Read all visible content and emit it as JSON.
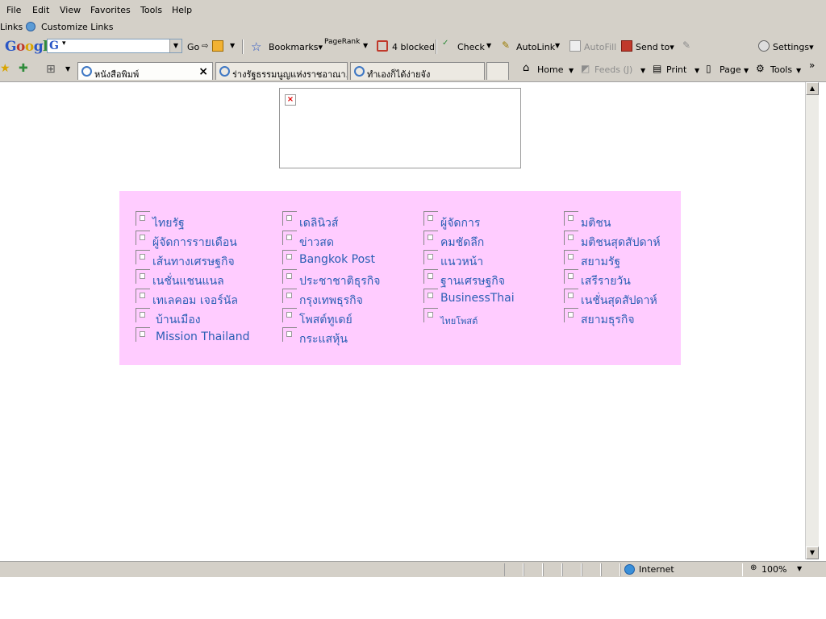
{
  "menubar": {
    "items": [
      "File",
      "Edit",
      "View",
      "Favorites",
      "Tools",
      "Help"
    ]
  },
  "linksbar": {
    "label": "Links",
    "customize": "Customize Links"
  },
  "google_toolbar": {
    "logo": "Google",
    "search_value": "",
    "go": "Go",
    "bookmarks": "Bookmarks",
    "pagerank": "PageRank",
    "pagerank_fraction": 0.55,
    "blocked": "4 blocked",
    "check": "Check",
    "autolink": "AutoLink",
    "autofill": "AutoFill",
    "sendto": "Send to",
    "settings": "Settings"
  },
  "tabs": [
    {
      "label": "หนังสือพิมพ์",
      "active": true
    },
    {
      "label": "ร่างรัฐธรรมนูญแห่งราชอาณา...",
      "active": false
    },
    {
      "label": "ทำเองก็ได้ง่ายจัง",
      "active": false
    }
  ],
  "commandbar": {
    "home": "Home",
    "feeds": "Feeds (J)",
    "print": "Print",
    "page": "Page",
    "tools": "Tools"
  },
  "newspapers": {
    "col1": [
      "ไทยรัฐ",
      "ผู้จัดการรายเดือน",
      "เส้นทางเศรษฐกิจ",
      "เนชั่นแชนแนล",
      "เทเลคอม เจอร์นัล",
      "บ้านเมือง",
      "Mission Thailand"
    ],
    "col2": [
      "เดลินิวส์",
      "ข่าวสด",
      "Bangkok Post",
      "ประชาชาติธุรกิจ",
      "กรุงเทพธุรกิจ",
      "โพสต์ทูเดย์",
      "กระแสหุ้น"
    ],
    "col3": [
      "ผู้จัดการ",
      "คมชัดลึก",
      "แนวหน้า",
      "ฐานเศรษฐกิจ",
      "BusinessThai",
      "ไทยโพสต์"
    ],
    "col4": [
      "มติชน",
      "มติชนสุดสัปดาห์",
      "สยามรัฐ",
      "เสรีรายวัน",
      "เนชั่นสุดสัปดาห์",
      "สยามธุรกิจ"
    ]
  },
  "statusbar": {
    "zone": "Internet",
    "zoom": "100%"
  },
  "colors": {
    "chrome": "#d4d0c8",
    "panel": "#ffccff",
    "link": "#2b5fb5"
  }
}
